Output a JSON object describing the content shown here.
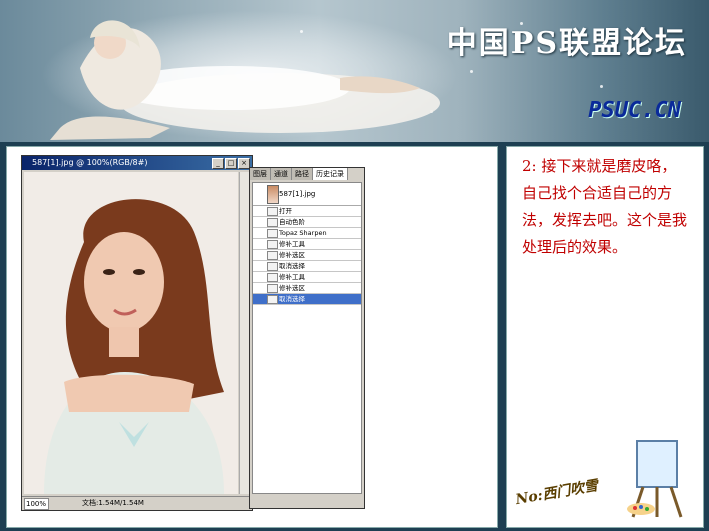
{
  "banner": {
    "site_title": "中国PS联盟论坛",
    "site_url": "PSUC.CN"
  },
  "photoshop": {
    "window_title": "587[1].jpg @ 100%(RGB/8#)",
    "zoom": "100%",
    "doc_info": "文档:1.54M/1.54M"
  },
  "history_panel": {
    "tabs": [
      "图层",
      "通道",
      "路径",
      "历史记录"
    ],
    "active_tab_index": 3,
    "snapshot": "587[1].jpg",
    "items": [
      {
        "label": "打开"
      },
      {
        "label": "自动色阶"
      },
      {
        "label": "Topaz Sharpen"
      },
      {
        "label": "修补工具"
      },
      {
        "label": "修补选区"
      },
      {
        "label": "取消选择"
      },
      {
        "label": "修补工具"
      },
      {
        "label": "修补选区"
      },
      {
        "label": "取消选择"
      }
    ],
    "selected_index": 8
  },
  "description": "2: 接下来就是磨皮咯，自己找个合适自己的方法，发挥去吧。这个是我处理后的效果。",
  "logo_text": "No:西门吹雪",
  "colors": {
    "frame": "#1e3f52",
    "description_text": "#c00000",
    "selection": "#3f6fc9"
  }
}
